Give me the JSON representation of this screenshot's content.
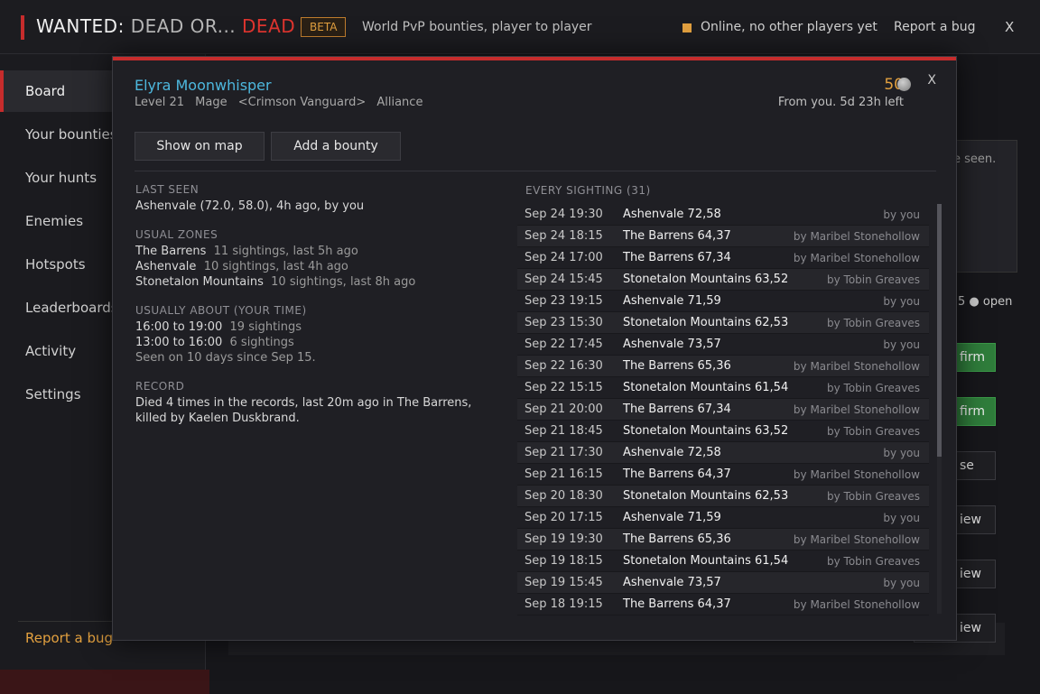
{
  "titlebar": {
    "title_main": "WANTED:",
    "title_mid": "DEAD OR...",
    "title_end": "DEAD",
    "beta": "BETA",
    "tagline": "World PvP bounties, player to player",
    "status": "Online, no other players yet",
    "status_color": "#e2a03f",
    "report": "Report a bug",
    "close": "X"
  },
  "sidebar": {
    "items": [
      {
        "label": "Board"
      },
      {
        "label": "Your bounties"
      },
      {
        "label": "Your hunts"
      },
      {
        "label": "Enemies"
      },
      {
        "label": "Hotspots"
      },
      {
        "label": "Leaderboards"
      },
      {
        "label": "Activity"
      },
      {
        "label": "Settings"
      }
    ],
    "report": "Report a bug"
  },
  "background": {
    "panel_text": "e seen.",
    "open_text": "5 ● open",
    "buttons": [
      "firm",
      "firm",
      "se",
      "iew",
      "iew",
      "iew"
    ]
  },
  "modal": {
    "name": "Elyra Moonwhisper",
    "level": "Level 21",
    "class": "Mage",
    "guild": "<Crimson Vanguard>",
    "faction": "Alliance",
    "bounty": "50",
    "from": "From you.  5d 23h left",
    "close": "X",
    "btn_map": "Show on map",
    "btn_bounty": "Add a bounty",
    "last_seen_h": "LAST SEEN",
    "last_seen": "Ashenvale (72.0, 58.0), 4h ago, by you",
    "zones_h": "USUAL ZONES",
    "zones": [
      {
        "zone": "The Barrens",
        "info": "11 sightings, last 5h ago"
      },
      {
        "zone": "Ashenvale",
        "info": "10 sightings, last 4h ago"
      },
      {
        "zone": "Stonetalon Mountains",
        "info": "10 sightings, last 8h ago"
      }
    ],
    "times_h": "USUALLY ABOUT (YOUR TIME)",
    "times": [
      {
        "range": "16:00 to 19:00",
        "info": "19 sightings"
      },
      {
        "range": "13:00 to 16:00",
        "info": "6 sightings"
      }
    ],
    "seen_days": "Seen on 10 days since Sep 15.",
    "record_h": "RECORD",
    "record": "Died 4 times in the records, last 20m ago in The Barrens, killed by Kaelen Duskbrand.",
    "sightings_h": "EVERY SIGHTING (31)",
    "sightings": [
      {
        "date": "Sep 24 19:30",
        "zone": "Ashenvale 72,58",
        "by": "by you"
      },
      {
        "date": "Sep 24 18:15",
        "zone": "The Barrens 64,37",
        "by": "by Maribel Stonehollow"
      },
      {
        "date": "Sep 24 17:00",
        "zone": "The Barrens 67,34",
        "by": "by Maribel Stonehollow"
      },
      {
        "date": "Sep 24 15:45",
        "zone": "Stonetalon Mountains 63,52",
        "by": "by Tobin Greaves"
      },
      {
        "date": "Sep 23 19:15",
        "zone": "Ashenvale 71,59",
        "by": "by you"
      },
      {
        "date": "Sep 23 15:30",
        "zone": "Stonetalon Mountains 62,53",
        "by": "by Tobin Greaves"
      },
      {
        "date": "Sep 22 17:45",
        "zone": "Ashenvale 73,57",
        "by": "by you"
      },
      {
        "date": "Sep 22 16:30",
        "zone": "The Barrens 65,36",
        "by": "by Maribel Stonehollow"
      },
      {
        "date": "Sep 22 15:15",
        "zone": "Stonetalon Mountains 61,54",
        "by": "by Tobin Greaves"
      },
      {
        "date": "Sep 21 20:00",
        "zone": "The Barrens 67,34",
        "by": "by Maribel Stonehollow"
      },
      {
        "date": "Sep 21 18:45",
        "zone": "Stonetalon Mountains 63,52",
        "by": "by Tobin Greaves"
      },
      {
        "date": "Sep 21 17:30",
        "zone": "Ashenvale 72,58",
        "by": "by you"
      },
      {
        "date": "Sep 21 16:15",
        "zone": "The Barrens 64,37",
        "by": "by Maribel Stonehollow"
      },
      {
        "date": "Sep 20 18:30",
        "zone": "Stonetalon Mountains 62,53",
        "by": "by Tobin Greaves"
      },
      {
        "date": "Sep 20 17:15",
        "zone": "Ashenvale 71,59",
        "by": "by you"
      },
      {
        "date": "Sep 19 19:30",
        "zone": "The Barrens 65,36",
        "by": "by Maribel Stonehollow"
      },
      {
        "date": "Sep 19 18:15",
        "zone": "Stonetalon Mountains 61,54",
        "by": "by Tobin Greaves"
      },
      {
        "date": "Sep 19 15:45",
        "zone": "Ashenvale 73,57",
        "by": "by you"
      },
      {
        "date": "Sep 18 19:15",
        "zone": "The Barrens 64,37",
        "by": "by Maribel Stonehollow"
      }
    ]
  }
}
